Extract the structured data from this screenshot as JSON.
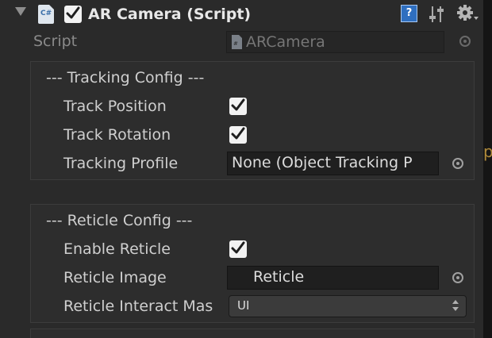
{
  "component": {
    "title": "AR Camera (Script)",
    "enabled": true,
    "script_icon_text": "C#",
    "help_icon": "question-mark-icon",
    "preset_icon": "sliders-icon",
    "gear_icon": "gear-icon"
  },
  "script_row": {
    "label": "Script",
    "value": "ARCamera"
  },
  "tracking_config": {
    "title": "--- Tracking Config ---",
    "track_position": {
      "label": "Track Position",
      "checked": true
    },
    "track_rotation": {
      "label": "Track Rotation",
      "checked": true
    },
    "tracking_profile": {
      "label": "Tracking Profile",
      "value": "None (Object Tracking P"
    }
  },
  "reticle_config": {
    "title": "--- Reticle Config ---",
    "enable_reticle": {
      "label": "Enable Reticle",
      "checked": true
    },
    "reticle_image": {
      "label": "Reticle Image",
      "value": "Reticle"
    },
    "reticle_interact_mask": {
      "label": "Reticle Interact Mas",
      "value": "UI"
    }
  },
  "background_text": "pe",
  "colors": {
    "panel_bg": "#2a2a2a",
    "group_bg": "#2d2d2d",
    "text": "#cfcfcf",
    "help_blue": "#2f6fc0"
  }
}
